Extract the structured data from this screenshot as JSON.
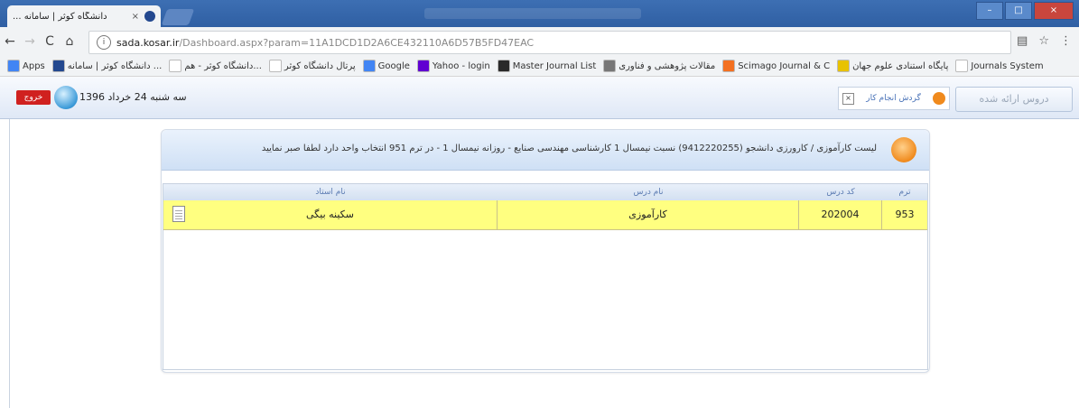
{
  "browser": {
    "tab_title": "دانشگاه کوثر | سامانه ...",
    "tab_close": "×",
    "url_host": "sada.kosar.ir",
    "url_path": "/Dashboard.aspx?param=11A1DCD1D2A6CE432110A6D57B5FD47EAC",
    "controls": {
      "minimize": "–",
      "maximize": "□",
      "close": "×"
    },
    "nav": {
      "back": "←",
      "forward": "→",
      "reload": "C",
      "home": "⌂"
    },
    "bookmarks": [
      {
        "label": "Apps",
        "icon": "apps-grid-icon",
        "color": "#4285f4"
      },
      {
        "label": "دانشگاه کوثر | سامانه ...",
        "icon": "kosar-logo-icon",
        "color": "#23488f"
      },
      {
        "label": "دانشگاه کوثر - هم...",
        "icon": "page-icon",
        "color": "#ffffff"
      },
      {
        "label": "پرتال دانشگاه کوثر",
        "icon": "page-icon",
        "color": "#ffffff"
      },
      {
        "label": "Google",
        "icon": "google-icon",
        "color": "#4285f4"
      },
      {
        "label": "Yahoo - login",
        "icon": "yahoo-icon",
        "color": "#6001d2"
      },
      {
        "label": "Master Journal List",
        "icon": "clarivate-icon",
        "color": "#2a2a2a"
      },
      {
        "label": "مقالات پژوهشی و فناوری",
        "icon": "page-icon",
        "color": "#777777"
      },
      {
        "label": "Scimago Journal & C",
        "icon": "scimago-icon",
        "color": "#f37021"
      },
      {
        "label": "پایگاه استنادی علوم جهان",
        "icon": "isc-icon",
        "color": "#e8c200"
      },
      {
        "label": "Journals System",
        "icon": "page-icon",
        "color": "#ffffff"
      }
    ]
  },
  "header": {
    "logout": "خروج",
    "date": "سه شنبه 24 خرداد 1396",
    "courses_button": "دروس ارائه شده",
    "steps_button": "گردش انجام کار"
  },
  "panel": {
    "title": "لیست کارآموزی / کارورزی دانشجو (9412220255) نسبت نیمسال 1 کارشناسی مهندسی صنایع - روزانه نیمسال 1 - در ترم 951 انتخاب واحد دارد لطفا صبر نمایید"
  },
  "table": {
    "headers": {
      "term": "ترم",
      "course_code": "کد درس",
      "course_name": "نام درس",
      "instructor": "نام استاد"
    },
    "rows": [
      {
        "term": "953",
        "course_code": "202004",
        "course_name": "کارآموزی",
        "instructor": "سکینه بیگی"
      }
    ]
  },
  "colors": {
    "highlight_row": "#ffff80",
    "logout": "#d0211f",
    "header_blue": "#cfe0f5"
  }
}
